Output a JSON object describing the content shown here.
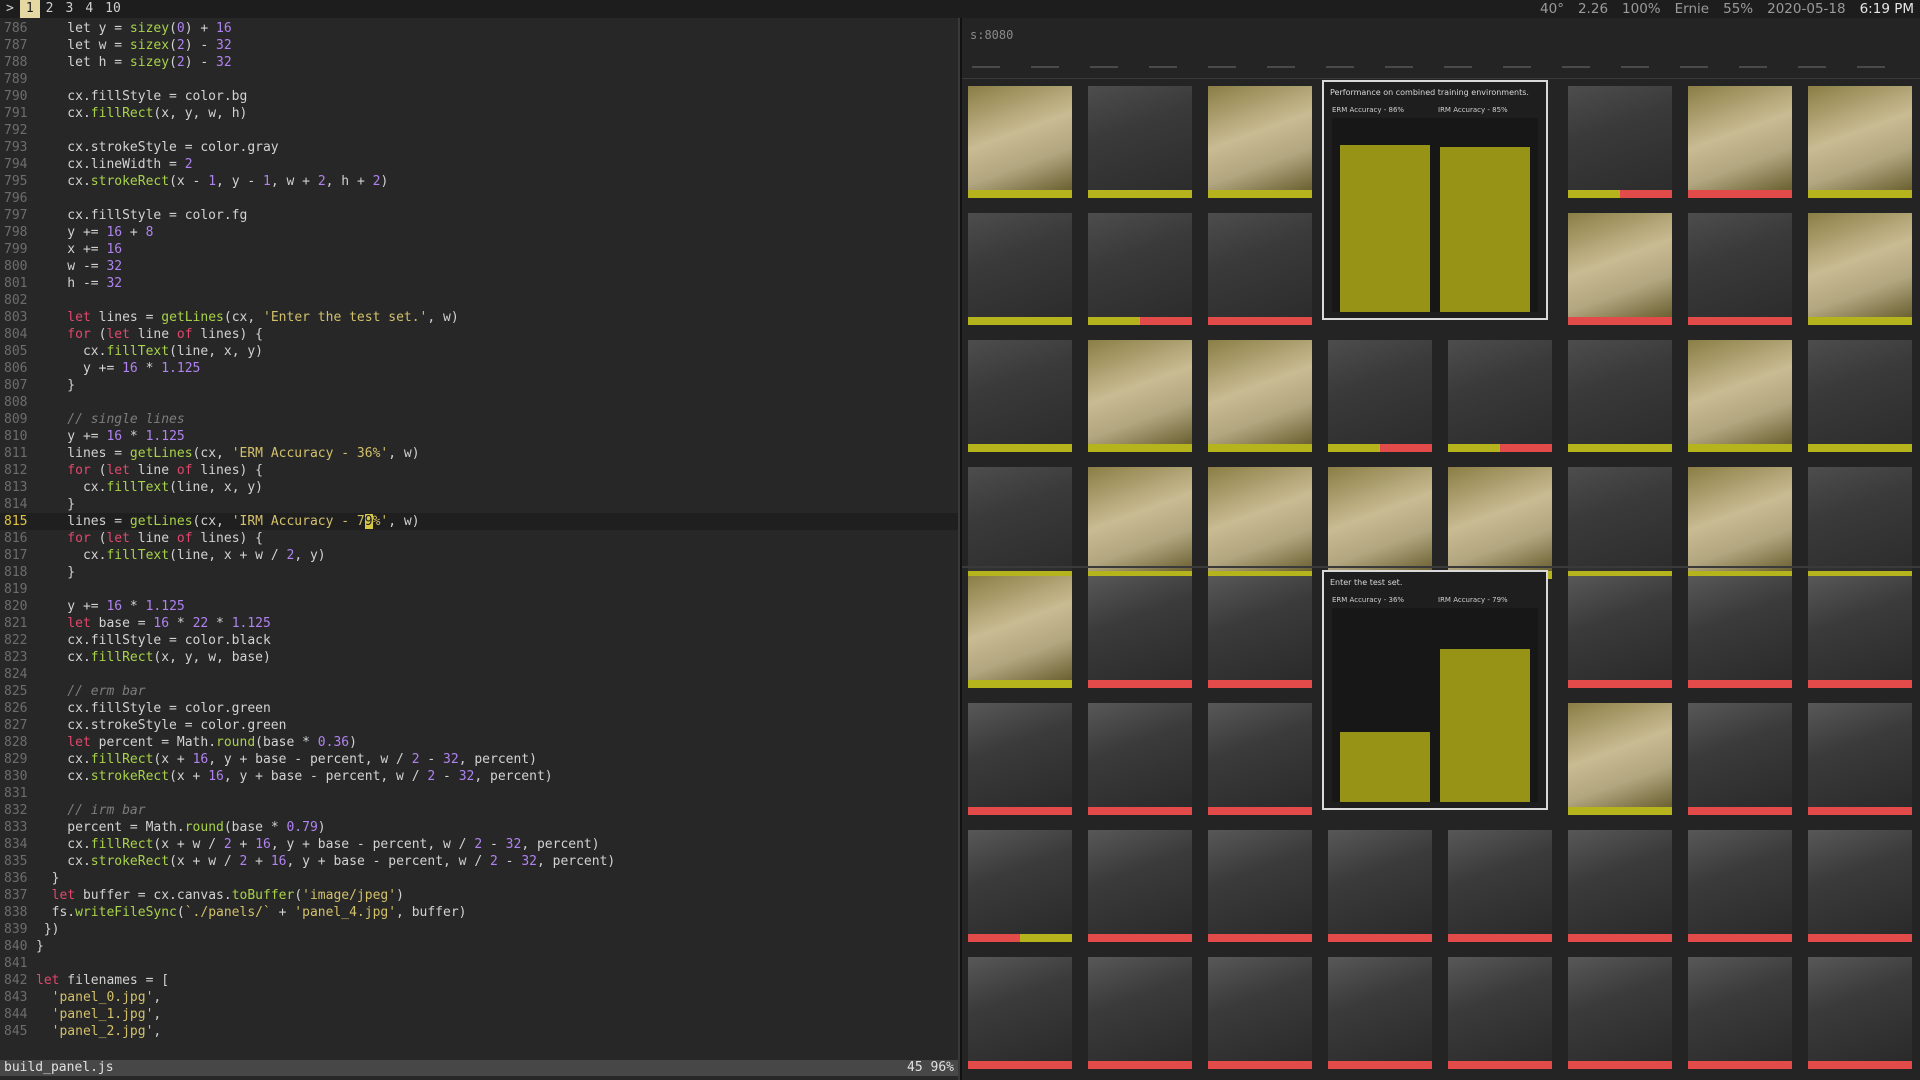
{
  "topbar": {
    "prompt": ">",
    "workspaces": [
      "1",
      "2",
      "3",
      "4",
      "10"
    ],
    "active_workspace": "1",
    "status": {
      "temp": "40°",
      "load": "2.26",
      "volume": "100%",
      "user": "Ernie",
      "battery": "55%",
      "date": "2020-05-18",
      "time": "6:19 PM"
    }
  },
  "editor": {
    "filename": "build_panel.js",
    "position": "45 96%",
    "current_line": "815",
    "lines": [
      {
        "n": "786",
        "segs": [
          [
            "txt",
            "    let y = "
          ],
          [
            "fn",
            "sizey"
          ],
          [
            "txt",
            "("
          ],
          [
            "num",
            "0"
          ],
          [
            "txt",
            ") + "
          ],
          [
            "num",
            "16"
          ]
        ]
      },
      {
        "n": "787",
        "segs": [
          [
            "txt",
            "    let w = "
          ],
          [
            "fn",
            "sizex"
          ],
          [
            "txt",
            "("
          ],
          [
            "num",
            "2"
          ],
          [
            "txt",
            ") - "
          ],
          [
            "num",
            "32"
          ]
        ]
      },
      {
        "n": "788",
        "segs": [
          [
            "txt",
            "    let h = "
          ],
          [
            "fn",
            "sizey"
          ],
          [
            "txt",
            "("
          ],
          [
            "num",
            "2"
          ],
          [
            "txt",
            ") - "
          ],
          [
            "num",
            "32"
          ]
        ]
      },
      {
        "n": "789",
        "segs": []
      },
      {
        "n": "790",
        "segs": [
          [
            "txt",
            "    cx.fillStyle = color.bg"
          ]
        ]
      },
      {
        "n": "791",
        "segs": [
          [
            "txt",
            "    cx."
          ],
          [
            "fn",
            "fillRect"
          ],
          [
            "txt",
            "(x, y, w, h)"
          ]
        ]
      },
      {
        "n": "792",
        "segs": []
      },
      {
        "n": "793",
        "segs": [
          [
            "txt",
            "    cx.strokeStyle = color.gray"
          ]
        ]
      },
      {
        "n": "794",
        "segs": [
          [
            "txt",
            "    cx.lineWidth = "
          ],
          [
            "num",
            "2"
          ]
        ]
      },
      {
        "n": "795",
        "segs": [
          [
            "txt",
            "    cx."
          ],
          [
            "fn",
            "strokeRect"
          ],
          [
            "txt",
            "(x - "
          ],
          [
            "num",
            "1"
          ],
          [
            "txt",
            ", y - "
          ],
          [
            "num",
            "1"
          ],
          [
            "txt",
            ", w + "
          ],
          [
            "num",
            "2"
          ],
          [
            "txt",
            ", h + "
          ],
          [
            "num",
            "2"
          ],
          [
            "txt",
            ")"
          ]
        ]
      },
      {
        "n": "796",
        "segs": []
      },
      {
        "n": "797",
        "segs": [
          [
            "txt",
            "    cx.fillStyle = color.fg"
          ]
        ]
      },
      {
        "n": "798",
        "segs": [
          [
            "txt",
            "    y += "
          ],
          [
            "num",
            "16"
          ],
          [
            "txt",
            " + "
          ],
          [
            "num",
            "8"
          ]
        ]
      },
      {
        "n": "799",
        "segs": [
          [
            "txt",
            "    x += "
          ],
          [
            "num",
            "16"
          ]
        ]
      },
      {
        "n": "800",
        "segs": [
          [
            "txt",
            "    w -= "
          ],
          [
            "num",
            "32"
          ]
        ]
      },
      {
        "n": "801",
        "segs": [
          [
            "txt",
            "    h -= "
          ],
          [
            "num",
            "32"
          ]
        ]
      },
      {
        "n": "802",
        "segs": []
      },
      {
        "n": "803",
        "segs": [
          [
            "kw",
            "    let"
          ],
          [
            "txt",
            " lines = "
          ],
          [
            "fn",
            "getLines"
          ],
          [
            "txt",
            "(cx, "
          ],
          [
            "str",
            "'Enter the test set.'"
          ],
          [
            "txt",
            ", w)"
          ]
        ]
      },
      {
        "n": "804",
        "segs": [
          [
            "kw",
            "    for"
          ],
          [
            "txt",
            " ("
          ],
          [
            "kw",
            "let"
          ],
          [
            "txt",
            " line "
          ],
          [
            "kw",
            "of"
          ],
          [
            "txt",
            " lines) {"
          ]
        ]
      },
      {
        "n": "805",
        "segs": [
          [
            "txt",
            "      cx."
          ],
          [
            "fn",
            "fillText"
          ],
          [
            "txt",
            "(line, x, y)"
          ]
        ]
      },
      {
        "n": "806",
        "segs": [
          [
            "txt",
            "      y += "
          ],
          [
            "num",
            "16"
          ],
          [
            "txt",
            " * "
          ],
          [
            "num",
            "1.125"
          ]
        ]
      },
      {
        "n": "807",
        "segs": [
          [
            "txt",
            "    }"
          ]
        ]
      },
      {
        "n": "808",
        "segs": []
      },
      {
        "n": "809",
        "segs": [
          [
            "cm",
            "    // single lines"
          ]
        ]
      },
      {
        "n": "810",
        "segs": [
          [
            "txt",
            "    y += "
          ],
          [
            "num",
            "16"
          ],
          [
            "txt",
            " * "
          ],
          [
            "num",
            "1.125"
          ]
        ]
      },
      {
        "n": "811",
        "segs": [
          [
            "txt",
            "    lines = "
          ],
          [
            "fn",
            "getLines"
          ],
          [
            "txt",
            "(cx, "
          ],
          [
            "str",
            "'ERM Accuracy - 36%'"
          ],
          [
            "txt",
            ", w)"
          ]
        ]
      },
      {
        "n": "812",
        "segs": [
          [
            "kw",
            "    for"
          ],
          [
            "txt",
            " ("
          ],
          [
            "kw",
            "let"
          ],
          [
            "txt",
            " line "
          ],
          [
            "kw",
            "of"
          ],
          [
            "txt",
            " lines) {"
          ]
        ]
      },
      {
        "n": "813",
        "segs": [
          [
            "txt",
            "      cx."
          ],
          [
            "fn",
            "fillText"
          ],
          [
            "txt",
            "(line, x, y)"
          ]
        ]
      },
      {
        "n": "814",
        "segs": [
          [
            "txt",
            "    }"
          ]
        ]
      },
      {
        "n": "815",
        "segs": [
          [
            "txt",
            "    lines = "
          ],
          [
            "fn",
            "getLines"
          ],
          [
            "txt",
            "(cx, "
          ],
          [
            "str",
            "'IRM Accuracy - 7"
          ],
          [
            "cursor",
            "9"
          ],
          [
            "str",
            "%'"
          ],
          [
            "txt",
            ", w)"
          ]
        ]
      },
      {
        "n": "816",
        "segs": [
          [
            "kw",
            "    for"
          ],
          [
            "txt",
            " ("
          ],
          [
            "kw",
            "let"
          ],
          [
            "txt",
            " line "
          ],
          [
            "kw",
            "of"
          ],
          [
            "txt",
            " lines) {"
          ]
        ]
      },
      {
        "n": "817",
        "segs": [
          [
            "txt",
            "      cx."
          ],
          [
            "fn",
            "fillText"
          ],
          [
            "txt",
            "(line, x + w / "
          ],
          [
            "num",
            "2"
          ],
          [
            "txt",
            ", y)"
          ]
        ]
      },
      {
        "n": "818",
        "segs": [
          [
            "txt",
            "    }"
          ]
        ]
      },
      {
        "n": "819",
        "segs": []
      },
      {
        "n": "820",
        "segs": [
          [
            "txt",
            "    y += "
          ],
          [
            "num",
            "16"
          ],
          [
            "txt",
            " * "
          ],
          [
            "num",
            "1.125"
          ]
        ]
      },
      {
        "n": "821",
        "segs": [
          [
            "kw",
            "    let"
          ],
          [
            "txt",
            " base = "
          ],
          [
            "num",
            "16"
          ],
          [
            "txt",
            " * "
          ],
          [
            "num",
            "22"
          ],
          [
            "txt",
            " * "
          ],
          [
            "num",
            "1.125"
          ]
        ]
      },
      {
        "n": "822",
        "segs": [
          [
            "txt",
            "    cx.fillStyle = color.black"
          ]
        ]
      },
      {
        "n": "823",
        "segs": [
          [
            "txt",
            "    cx."
          ],
          [
            "fn",
            "fillRect"
          ],
          [
            "txt",
            "(x, y, w, base)"
          ]
        ]
      },
      {
        "n": "824",
        "segs": []
      },
      {
        "n": "825",
        "segs": [
          [
            "cm",
            "    // erm bar"
          ]
        ]
      },
      {
        "n": "826",
        "segs": [
          [
            "txt",
            "    cx.fillStyle = color.green"
          ]
        ]
      },
      {
        "n": "827",
        "segs": [
          [
            "txt",
            "    cx.strokeStyle = color.green"
          ]
        ]
      },
      {
        "n": "828",
        "segs": [
          [
            "kw",
            "    let"
          ],
          [
            "txt",
            " percent = Math."
          ],
          [
            "fn",
            "round"
          ],
          [
            "txt",
            "(base * "
          ],
          [
            "num",
            "0.36"
          ],
          [
            "txt",
            ")"
          ]
        ]
      },
      {
        "n": "829",
        "segs": [
          [
            "txt",
            "    cx."
          ],
          [
            "fn",
            "fillRect"
          ],
          [
            "txt",
            "(x + "
          ],
          [
            "num",
            "16"
          ],
          [
            "txt",
            ", y + base - percent, w / "
          ],
          [
            "num",
            "2"
          ],
          [
            "txt",
            " - "
          ],
          [
            "num",
            "32"
          ],
          [
            "txt",
            ", percent)"
          ]
        ]
      },
      {
        "n": "830",
        "segs": [
          [
            "txt",
            "    cx."
          ],
          [
            "fn",
            "strokeRect"
          ],
          [
            "txt",
            "(x + "
          ],
          [
            "num",
            "16"
          ],
          [
            "txt",
            ", y + base - percent, w / "
          ],
          [
            "num",
            "2"
          ],
          [
            "txt",
            " - "
          ],
          [
            "num",
            "32"
          ],
          [
            "txt",
            ", percent)"
          ]
        ]
      },
      {
        "n": "831",
        "segs": []
      },
      {
        "n": "832",
        "segs": [
          [
            "cm",
            "    // irm bar"
          ]
        ]
      },
      {
        "n": "833",
        "segs": [
          [
            "txt",
            "    percent = Math."
          ],
          [
            "fn",
            "round"
          ],
          [
            "txt",
            "(base * "
          ],
          [
            "num",
            "0.79"
          ],
          [
            "txt",
            ")"
          ]
        ]
      },
      {
        "n": "834",
        "segs": [
          [
            "txt",
            "    cx."
          ],
          [
            "fn",
            "fillRect"
          ],
          [
            "txt",
            "(x + w / "
          ],
          [
            "num",
            "2"
          ],
          [
            "txt",
            " + "
          ],
          [
            "num",
            "16"
          ],
          [
            "txt",
            ", y + base - percent, w / "
          ],
          [
            "num",
            "2"
          ],
          [
            "txt",
            " - "
          ],
          [
            "num",
            "32"
          ],
          [
            "txt",
            ", percent)"
          ]
        ]
      },
      {
        "n": "835",
        "segs": [
          [
            "txt",
            "    cx."
          ],
          [
            "fn",
            "strokeRect"
          ],
          [
            "txt",
            "(x + w / "
          ],
          [
            "num",
            "2"
          ],
          [
            "txt",
            " + "
          ],
          [
            "num",
            "16"
          ],
          [
            "txt",
            ", y + base - percent, w / "
          ],
          [
            "num",
            "2"
          ],
          [
            "txt",
            " - "
          ],
          [
            "num",
            "32"
          ],
          [
            "txt",
            ", percent)"
          ]
        ]
      },
      {
        "n": "836",
        "segs": [
          [
            "txt",
            "  }"
          ]
        ]
      },
      {
        "n": "837",
        "segs": [
          [
            "kw",
            "  let"
          ],
          [
            "txt",
            " buffer = cx.canvas."
          ],
          [
            "fn",
            "toBuffer"
          ],
          [
            "txt",
            "("
          ],
          [
            "str",
            "'image/jpeg'"
          ],
          [
            "txt",
            ")"
          ]
        ]
      },
      {
        "n": "838",
        "segs": [
          [
            "txt",
            "  fs."
          ],
          [
            "fn",
            "writeFileSync"
          ],
          [
            "txt",
            "("
          ],
          [
            "str",
            "`./panels/`"
          ],
          [
            "txt",
            " + "
          ],
          [
            "str",
            "'panel_4.jpg'"
          ],
          [
            "txt",
            ", buffer)"
          ]
        ]
      },
      {
        "n": "839",
        "segs": [
          [
            "txt",
            " })"
          ]
        ]
      },
      {
        "n": "840",
        "segs": [
          [
            "txt",
            "}"
          ]
        ]
      },
      {
        "n": "841",
        "segs": []
      },
      {
        "n": "842",
        "segs": [
          [
            "kw",
            "let"
          ],
          [
            "txt",
            " filenames = ["
          ]
        ]
      },
      {
        "n": "843",
        "segs": [
          [
            "str",
            "  'panel_0.jpg'"
          ],
          [
            "txt",
            ","
          ]
        ]
      },
      {
        "n": "844",
        "segs": [
          [
            "str",
            "  'panel_1.jpg'"
          ],
          [
            "txt",
            ","
          ]
        ]
      },
      {
        "n": "845",
        "segs": [
          [
            "str",
            "  'panel_2.jpg'"
          ],
          [
            "txt",
            ","
          ]
        ]
      }
    ]
  },
  "viewer": {
    "title": "s:8080",
    "panel_top": {
      "title": "Performance on combined training environments.",
      "label_a": "ERM Accuracy - 86%",
      "label_b": "IRM Accuracy - 85%",
      "erm": 0.86,
      "irm": 0.85
    },
    "panel_bottom": {
      "title": "Enter the test set.",
      "label_a": "ERM Accuracy - 36%",
      "label_b": "IRM Accuracy - 79%",
      "erm": 0.36,
      "irm": 0.79
    },
    "colors": {
      "good": "#b6b41c",
      "bad": "#e34b4b",
      "bar": "#979316"
    }
  }
}
